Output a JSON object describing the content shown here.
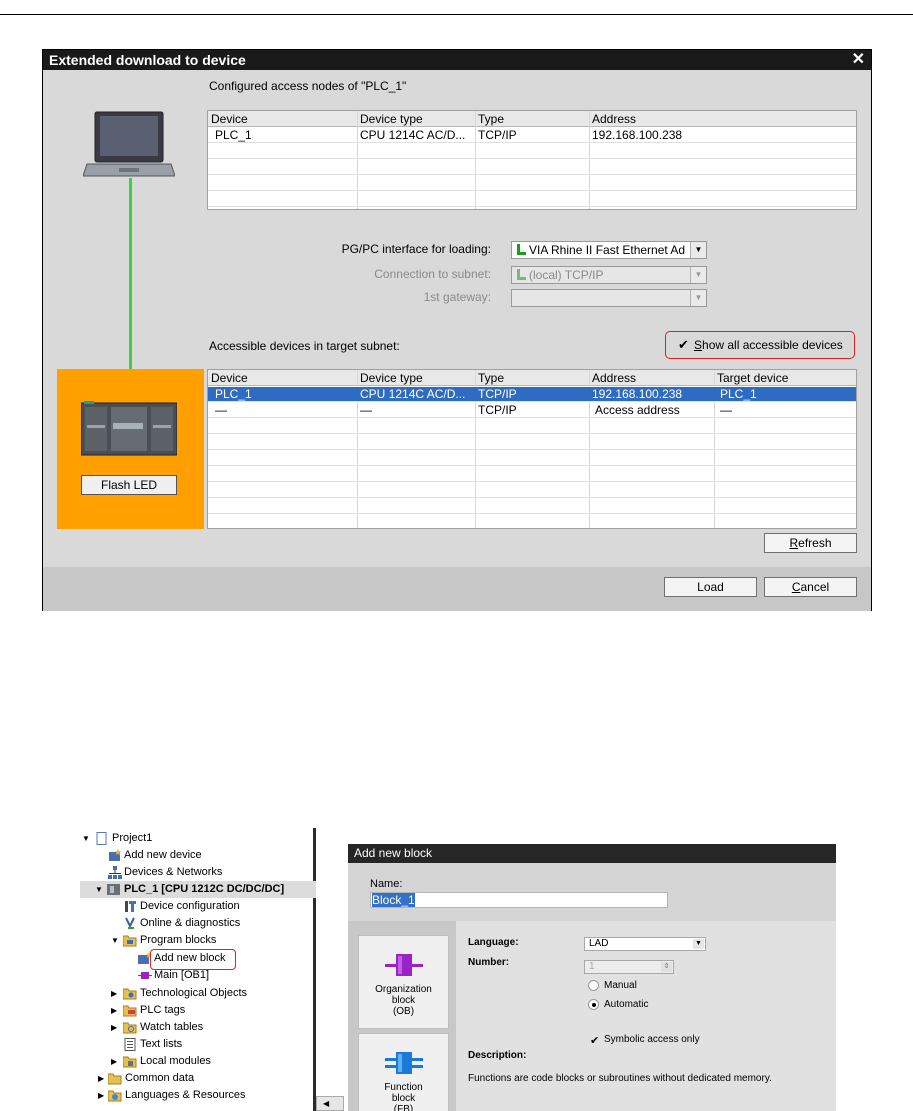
{
  "dialog": {
    "title": "Extended download to device",
    "close_glyph": "✕",
    "configured_label": "Configured access nodes of \"PLC_1\"",
    "configured_columns": [
      "Device",
      "Device type",
      "Type",
      "Address"
    ],
    "configured_rows": [
      [
        "PLC_1",
        "CPU 1214C AC/D...",
        "TCP/IP",
        "192.168.100.238"
      ]
    ],
    "pgpc_label": "PG/PC interface for loading:",
    "pgpc_value": "VIA Rhine II Fast Ethernet Ad",
    "subnet_label": "Connection to subnet:",
    "subnet_value": "(local) TCP/IP",
    "gateway_label": "1st gateway:",
    "gateway_value": "",
    "accessible_label": "Accessible devices in target subnet:",
    "show_all_label": "Show all accessible devices",
    "show_all_checked": true,
    "accessible_columns": [
      "Device",
      "Device type",
      "Type",
      "Address",
      "Target device"
    ],
    "accessible_rows": [
      [
        "PLC_1",
        "CPU 1214C AC/D...",
        "TCP/IP",
        "192.168.100.238",
        "PLC_1"
      ],
      [
        "—",
        "—",
        "TCP/IP",
        "Access address",
        "—"
      ]
    ],
    "flash_led_label": "Flash LED",
    "refresh_label": "Refresh",
    "load_label": "Load",
    "cancel_label": "Cancel",
    "colors": {
      "plc_panel": "#ff9f00",
      "link_line": "#3cd13c",
      "selection": "#2e6cc4",
      "highlight_border": "#e02020"
    }
  },
  "tree": {
    "items": [
      {
        "label": "Project1",
        "icon": "project-icon"
      },
      {
        "label": "Add new device",
        "icon": "add-device-icon"
      },
      {
        "label": "Devices & Networks",
        "icon": "network-icon"
      },
      {
        "label": "PLC_1 [CPU 1212C DC/DC/DC]",
        "icon": "plc-icon"
      },
      {
        "label": "Device configuration",
        "icon": "device-config-icon"
      },
      {
        "label": "Online & diagnostics",
        "icon": "diagnostics-icon"
      },
      {
        "label": "Program blocks",
        "icon": "folder-icon"
      },
      {
        "label": "Add new block",
        "icon": "add-block-icon"
      },
      {
        "label": "Main [OB1]",
        "icon": "ob-icon"
      },
      {
        "label": "Technological Objects",
        "icon": "folder-icon"
      },
      {
        "label": "PLC tags",
        "icon": "tags-icon"
      },
      {
        "label": "Watch tables",
        "icon": "watch-table-icon"
      },
      {
        "label": "Text lists",
        "icon": "text-list-icon"
      },
      {
        "label": "Local modules",
        "icon": "modules-icon"
      },
      {
        "label": "Common data",
        "icon": "folder-icon"
      },
      {
        "label": "Languages & Resources",
        "icon": "languages-icon"
      }
    ]
  },
  "add_block": {
    "title": "Add new block",
    "name_label": "Name:",
    "name_value": "Block_1",
    "blocks": [
      {
        "label": "Organization block (OB)"
      },
      {
        "label": "Function block (FB)"
      }
    ],
    "language_label": "Language:",
    "language_value": "LAD",
    "number_label": "Number:",
    "number_value": "1",
    "manual_label": "Manual",
    "automatic_label": "Automatic",
    "automatic_selected": true,
    "symbolic_label": "Symbolic access only",
    "symbolic_checked": true,
    "description_label": "Description:",
    "description_text": "Functions are code blocks or subroutines without dedicated memory."
  }
}
